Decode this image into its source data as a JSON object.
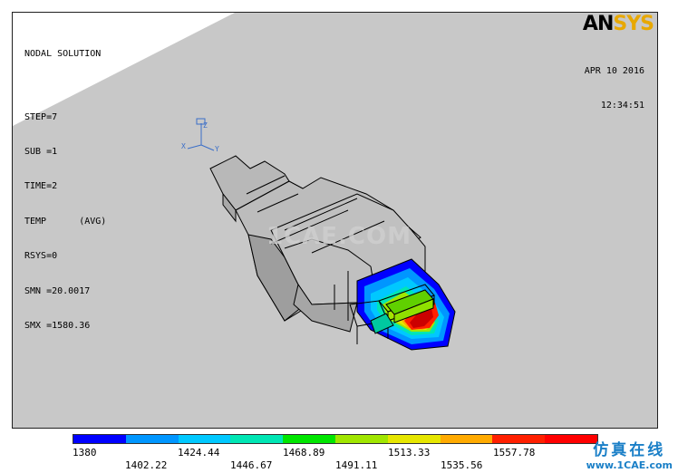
{
  "info": {
    "title": "NODAL SOLUTION",
    "step": "STEP=7",
    "sub": "SUB =1",
    "time": "TIME=2",
    "temp": "TEMP      (AVG)",
    "rsys": "RSYS=0",
    "smn": "SMN =20.0017",
    "smx": "SMX =1580.36"
  },
  "logo": {
    "an": "AN",
    "sys": "SYS"
  },
  "date": {
    "date": "APR 10 2016",
    "time": "12:34:51"
  },
  "triad": {
    "z": "Z",
    "x": "X",
    "y": "Y"
  },
  "watermark": "1CAE.COM",
  "legend": {
    "colors": [
      "#0000ff",
      "#0096ff",
      "#00c8ff",
      "#00e6b4",
      "#00e600",
      "#a0e600",
      "#e6e600",
      "#ffaa00",
      "#ff2000",
      "#ff0000"
    ],
    "top_labels": [
      "1380",
      "1424.44",
      "1468.89",
      "1513.33",
      "1557.78"
    ],
    "bottom_labels": [
      "1402.22",
      "1446.67",
      "1491.11",
      "1535.56"
    ]
  },
  "site": {
    "cn": "仿真在线",
    "url": "www.1CAE.com"
  }
}
